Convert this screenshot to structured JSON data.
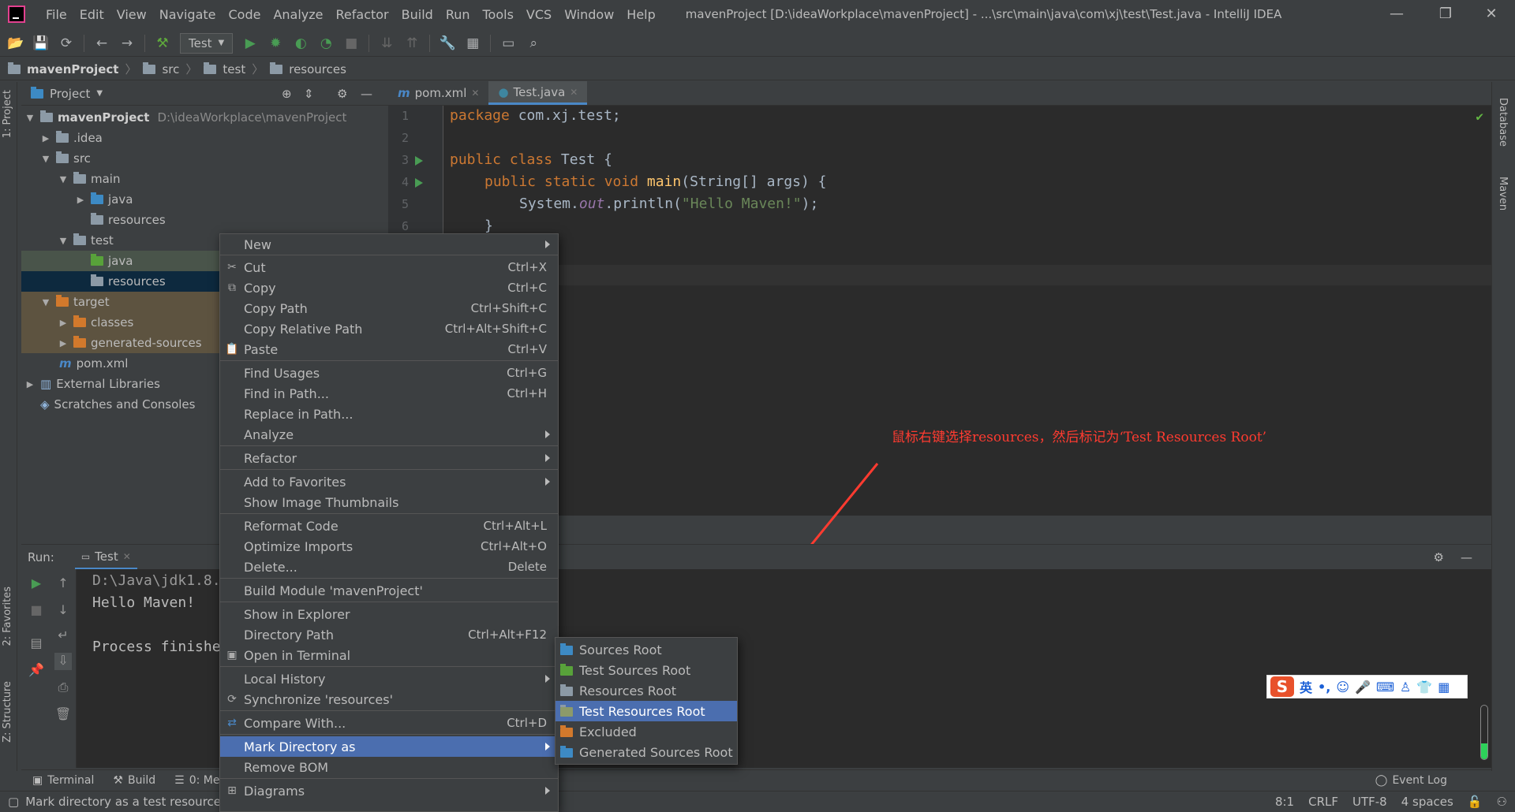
{
  "menubar": {
    "items": [
      "File",
      "Edit",
      "View",
      "Navigate",
      "Code",
      "Analyze",
      "Refactor",
      "Build",
      "Run",
      "Tools",
      "VCS",
      "Window",
      "Help"
    ],
    "title": "mavenProject [D:\\ideaWorkplace\\mavenProject] - ...\\src\\main\\java\\com\\xj\\test\\Test.java - IntelliJ IDEA"
  },
  "toolbar": {
    "run_config": "Test"
  },
  "breadcrumb": [
    "mavenProject",
    "src",
    "test",
    "resources"
  ],
  "project_panel": {
    "title": "Project",
    "tree": [
      {
        "label": "mavenProject",
        "path": "D:\\ideaWorkplace\\mavenProject"
      },
      {
        "label": ".idea"
      },
      {
        "label": "src"
      },
      {
        "label": "main"
      },
      {
        "label": "java"
      },
      {
        "label": "resources"
      },
      {
        "label": "test"
      },
      {
        "label": "java"
      },
      {
        "label": "resources"
      },
      {
        "label": "target"
      },
      {
        "label": "classes"
      },
      {
        "label": "generated-sources"
      },
      {
        "label": "pom.xml"
      },
      {
        "label": "External Libraries"
      },
      {
        "label": "Scratches and Consoles"
      }
    ]
  },
  "editor": {
    "tabs": [
      "pom.xml",
      "Test.java"
    ],
    "line_numbers": [
      "1",
      "2",
      "3",
      "4",
      "5",
      "6"
    ],
    "code": {
      "l1_kw": "package",
      "l1_rest": " com.xj.test;",
      "l3_kw": "public class",
      "l3_rest": " Test {",
      "l4_kw": "public static void",
      "l4_fn": "main",
      "l4_rest": "(String[] args) {",
      "l5_a": "System.",
      "l5_out": "out",
      "l5_b": ".println(",
      "l5_str": "\"Hello Maven!\"",
      "l5_c": ");",
      "l6": "}"
    }
  },
  "annotation": "鼠标右键选择resources，然后标记为‘Test Resources Root’",
  "run_panel": {
    "label": "Run:",
    "tab": "Test",
    "output": [
      "D:\\Java\\jdk1.8.",
      "Hello Maven!",
      "",
      "Process finishe"
    ]
  },
  "context_menu": {
    "items": [
      {
        "label": "New",
        "shortcut": "",
        "submenu": true
      },
      {
        "label": "Cut",
        "shortcut": "Ctrl+X"
      },
      {
        "label": "Copy",
        "shortcut": "Ctrl+C"
      },
      {
        "label": "Copy Path",
        "shortcut": "Ctrl+Shift+C"
      },
      {
        "label": "Copy Relative Path",
        "shortcut": "Ctrl+Alt+Shift+C"
      },
      {
        "label": "Paste",
        "shortcut": "Ctrl+V"
      },
      {
        "label": "Find Usages",
        "shortcut": "Ctrl+G"
      },
      {
        "label": "Find in Path...",
        "shortcut": "Ctrl+H"
      },
      {
        "label": "Replace in Path...",
        "shortcut": ""
      },
      {
        "label": "Analyze",
        "shortcut": "",
        "submenu": true
      },
      {
        "label": "Refactor",
        "shortcut": "",
        "submenu": true
      },
      {
        "label": "Add to Favorites",
        "shortcut": "",
        "submenu": true
      },
      {
        "label": "Show Image Thumbnails",
        "shortcut": ""
      },
      {
        "label": "Reformat Code",
        "shortcut": "Ctrl+Alt+L"
      },
      {
        "label": "Optimize Imports",
        "shortcut": "Ctrl+Alt+O"
      },
      {
        "label": "Delete...",
        "shortcut": "Delete"
      },
      {
        "label": "Build Module 'mavenProject'",
        "shortcut": ""
      },
      {
        "label": "Show in Explorer",
        "shortcut": ""
      },
      {
        "label": "Directory Path",
        "shortcut": "Ctrl+Alt+F12"
      },
      {
        "label": "Open in Terminal",
        "shortcut": ""
      },
      {
        "label": "Local History",
        "shortcut": "",
        "submenu": true
      },
      {
        "label": "Synchronize 'resources'",
        "shortcut": ""
      },
      {
        "label": "Compare With...",
        "shortcut": "Ctrl+D"
      },
      {
        "label": "Mark Directory as",
        "shortcut": "",
        "submenu": true
      },
      {
        "label": "Remove BOM",
        "shortcut": ""
      },
      {
        "label": "Diagrams",
        "shortcut": "",
        "submenu": true
      }
    ]
  },
  "submenu": {
    "items": [
      "Sources Root",
      "Test Sources Root",
      "Resources Root",
      "Test Resources Root",
      "Excluded",
      "Generated Sources Root"
    ],
    "highlighted": "Test Resources Root"
  },
  "bottom_tools": [
    "Terminal",
    "Build",
    "0: Mes"
  ],
  "left_stripe": [
    "1: Project",
    "2: Favorites",
    "Z: Structure"
  ],
  "right_stripe": [
    "Database",
    "Maven"
  ],
  "statusbar": {
    "message": "Mark directory as a test resources",
    "event_log": "Event Log",
    "position": "8:1",
    "line_sep": "CRLF",
    "encoding": "UTF-8",
    "indent": "4 spaces"
  },
  "ime": {
    "logo": "S",
    "mode": "英"
  },
  "colors": {
    "highlight": "#4b6eaf",
    "selected_row": "#0d293e",
    "annotation": "#ff3b30",
    "keyword": "#cc7832",
    "string": "#6a8759"
  }
}
